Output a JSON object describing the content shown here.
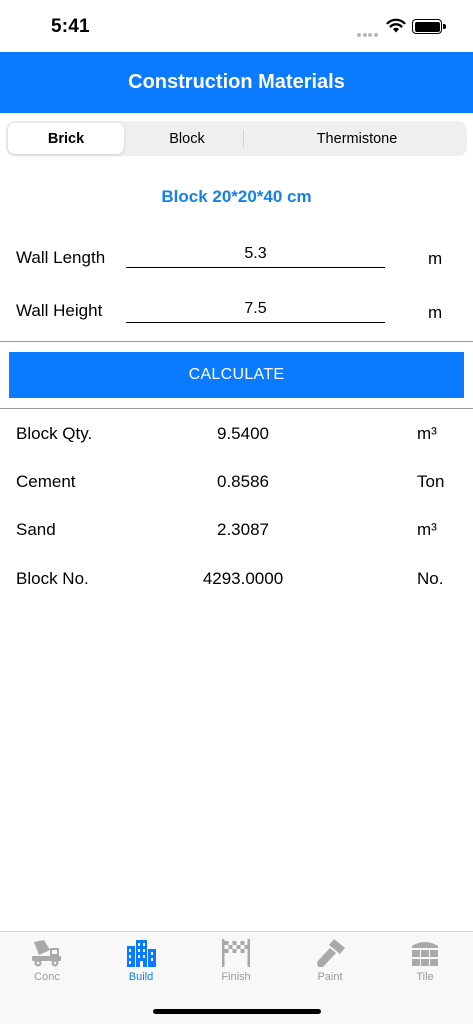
{
  "status": {
    "time": "5:41"
  },
  "nav": {
    "title": "Construction Materials"
  },
  "segments": [
    {
      "label": "Brick",
      "active": true
    },
    {
      "label": "Block",
      "active": false
    },
    {
      "label": "Thermistone",
      "active": false
    }
  ],
  "section_title": "Block 20*20*40 cm",
  "form": {
    "wall_length": {
      "label": "Wall Length",
      "value": "5.3",
      "unit": "m"
    },
    "wall_height": {
      "label": "Wall Height",
      "value": "7.5",
      "unit": "m"
    }
  },
  "calculate_label": "CALCULATE",
  "results": [
    {
      "label": "Block Qty.",
      "value": "9.5400",
      "unit": "m³"
    },
    {
      "label": "Cement",
      "value": "0.8586",
      "unit": "Ton"
    },
    {
      "label": "Sand",
      "value": "2.3087",
      "unit": "m³"
    },
    {
      "label": "Block No.",
      "value": "4293.0000",
      "unit": "No."
    }
  ],
  "tabs": [
    {
      "label": "Conc",
      "icon": "concrete-mixer-icon",
      "active": false
    },
    {
      "label": "Build",
      "icon": "building-icon",
      "active": true
    },
    {
      "label": "Finish",
      "icon": "finish-flag-icon",
      "active": false
    },
    {
      "label": "Paint",
      "icon": "paint-roller-icon",
      "active": false
    },
    {
      "label": "Tile",
      "icon": "tile-icon",
      "active": false
    }
  ],
  "colors": {
    "accent": "#0a7bff",
    "title": "#1580e8",
    "inactive": "#9a9a9a"
  }
}
